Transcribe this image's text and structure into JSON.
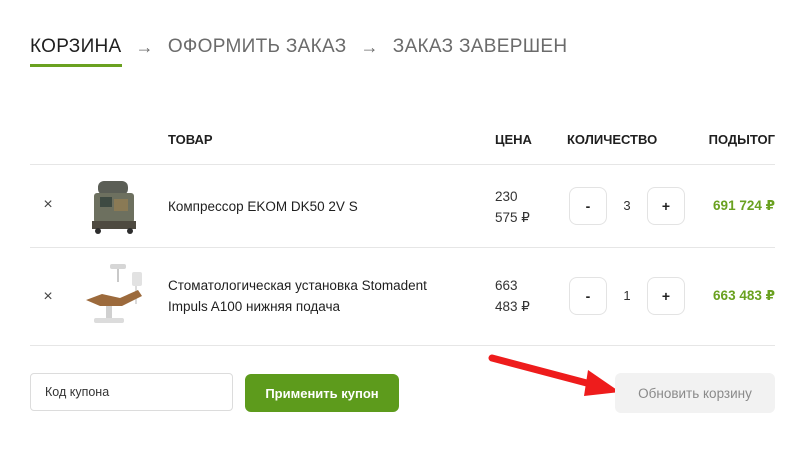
{
  "breadcrumb": {
    "steps": [
      "КОРЗИНА",
      "ОФОРМИТЬ ЗАКАЗ",
      "ЗАКАЗ ЗАВЕРШЕН"
    ],
    "separator": "→",
    "active_index": 0
  },
  "table": {
    "headers": {
      "product": "ТОВАР",
      "price": "ЦЕНА",
      "quantity": "КОЛИЧЕСТВО",
      "subtotal": "ПОДЫТОГ"
    },
    "rows": [
      {
        "remove_symbol": "×",
        "image_icon": "compressor-image",
        "name_line1": "Компрессор EKOM DK50 2V S",
        "name_line2": "",
        "price_line1": "230",
        "price_line2": "575 ₽",
        "minus": "-",
        "quantity": "3",
        "plus": "+",
        "subtotal": "691 724 ₽"
      },
      {
        "remove_symbol": "×",
        "image_icon": "dental-unit-image",
        "name_line1": "Стоматологическая установка Stomadent",
        "name_line2": "Impuls A100 нижняя подача",
        "price_line1": "663",
        "price_line2": "483 ₽",
        "minus": "-",
        "quantity": "1",
        "plus": "+",
        "subtotal": "663 483 ₽"
      }
    ]
  },
  "coupon": {
    "placeholder": "Код купона",
    "apply_label": "Применить купон"
  },
  "update_cart_label": "Обновить корзину",
  "colors": {
    "accent": "#6aa120",
    "button_green": "#5d9b1c",
    "annotation_arrow": "#ee1c1c"
  }
}
